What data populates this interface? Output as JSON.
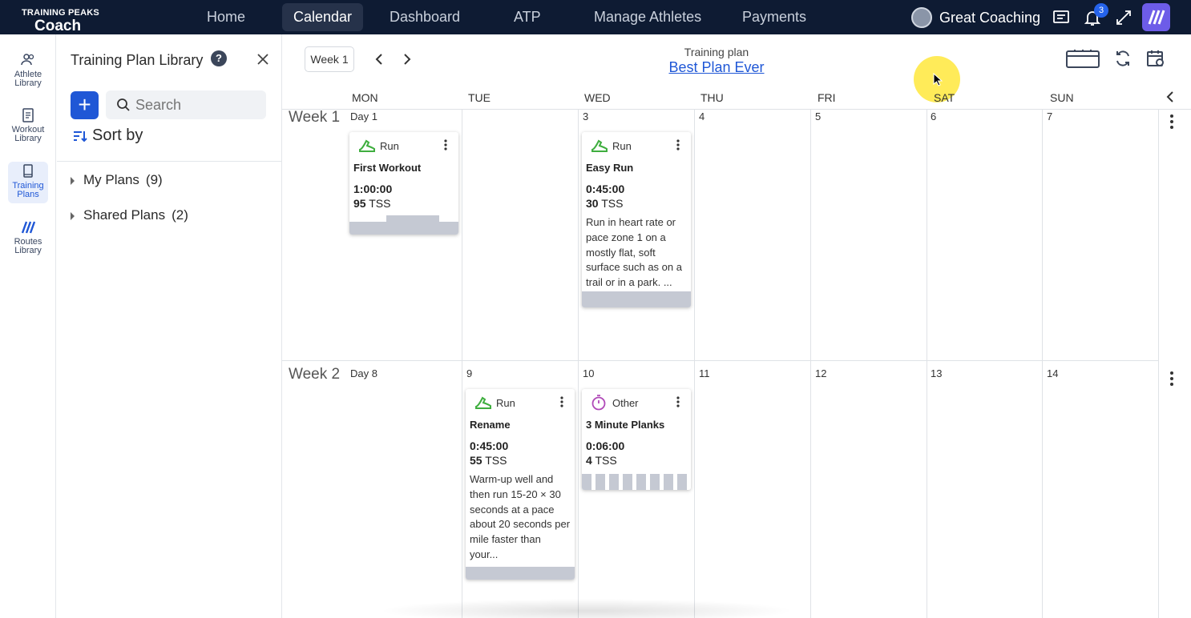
{
  "app": {
    "logo_top": "TRAINING PEAKS",
    "logo_bottom": "Coach",
    "nav": [
      "Home",
      "Calendar",
      "Dashboard",
      "ATP",
      "Manage Athletes",
      "Payments"
    ],
    "active_nav": "Calendar",
    "user_name": "Great Coaching",
    "notification_count": "3"
  },
  "rail": {
    "items": [
      {
        "label_line1": "Athlete",
        "label_line2": "Library",
        "icon": "athletes-icon"
      },
      {
        "label_line1": "Workout",
        "label_line2": "Library",
        "icon": "workout-library-icon"
      },
      {
        "label_line1": "Training",
        "label_line2": "Plans",
        "icon": "book-icon"
      },
      {
        "label_line1": "Routes",
        "label_line2": "Library",
        "icon": "routes-icon"
      }
    ]
  },
  "library": {
    "title": "Training Plan Library",
    "help": "?",
    "add": "+",
    "search_placeholder": "Search",
    "sort_label": "Sort by",
    "groups": [
      {
        "label": "My Plans",
        "count": "(9)"
      },
      {
        "label": "Shared Plans",
        "count": "(2)"
      }
    ]
  },
  "calendar": {
    "week_button": "Week 1",
    "plan_label": "Training plan",
    "plan_name": "Best Plan Ever",
    "days": [
      "MON",
      "TUE",
      "WED",
      "THU",
      "FRI",
      "SAT",
      "SUN"
    ],
    "weeks": [
      {
        "label": "Week 1",
        "day_numbers": [
          "Day 1",
          "",
          "3",
          "4",
          "5",
          "6",
          "7"
        ]
      },
      {
        "label": "Week 2",
        "day_numbers": [
          "Day 8",
          "9",
          "10",
          "11",
          "12",
          "13",
          "14"
        ]
      }
    ],
    "workouts": [
      {
        "type": "Run",
        "title": "First Workout",
        "duration": "1:00:00",
        "tss_value": "95",
        "tss_unit": "TSS",
        "description": ""
      },
      {
        "type": "Run",
        "title": "Easy Run",
        "duration": "0:45:00",
        "tss_value": "30",
        "tss_unit": "TSS",
        "description": "Run in heart rate or pace zone 1 on a mostly flat, soft surface such as on a trail or in a park. ..."
      },
      {
        "type": "Run",
        "title": "Rename",
        "duration": "0:45:00",
        "tss_value": "55",
        "tss_unit": "TSS",
        "description": "Warm-up well and then run 15-20 × 30 seconds at a pace about 20 seconds per mile faster than your..."
      },
      {
        "type": "Other",
        "title": "3 Minute Planks",
        "duration": "0:06:00",
        "tss_value": "4",
        "tss_unit": "TSS",
        "description": ""
      }
    ]
  },
  "colors": {
    "topbar": "#0e1b33",
    "accent": "#1f57d6",
    "run_icon": "#3fae3f",
    "other_icon": "#b04ab8"
  }
}
